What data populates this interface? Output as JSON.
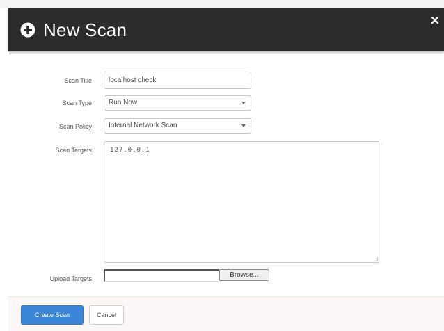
{
  "dialog": {
    "title": "New Scan",
    "icons": {
      "header": "plus-circle-icon",
      "close": "close-icon"
    }
  },
  "form": {
    "scan_title": {
      "label": "Scan Title",
      "value": "localhost check"
    },
    "scan_type": {
      "label": "Scan Type",
      "value": "Run Now"
    },
    "scan_policy": {
      "label": "Scan Policy",
      "value": "Internal Network Scan"
    },
    "scan_targets": {
      "label": "Scan Targets",
      "value": "127.0.0.1"
    },
    "upload_targets": {
      "label": "Upload Targets",
      "value": "",
      "browse_label": "Browse..."
    }
  },
  "footer": {
    "create_label": "Create Scan",
    "cancel_label": "Cancel"
  },
  "colors": {
    "header_bg": "#2a2c2e",
    "header_text": "#ffffff",
    "primary_button": "#3b86d8",
    "footer_bg": "#fbf7f7"
  }
}
